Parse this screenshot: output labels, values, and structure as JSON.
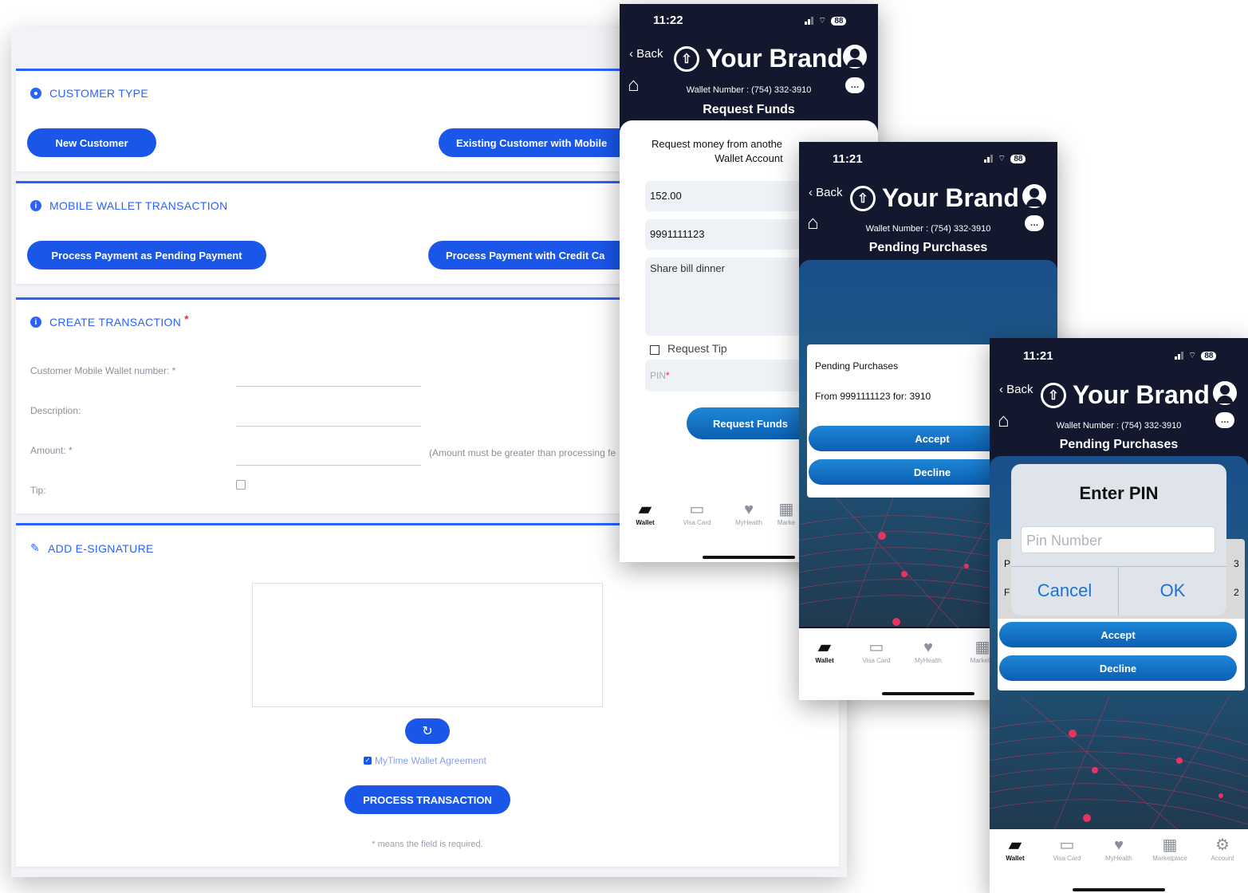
{
  "desktop": {
    "customer_type": {
      "title": "CUSTOMER TYPE",
      "btn_new": "New Customer",
      "btn_existing": "Existing Customer with Mobile"
    },
    "mobile_wallet": {
      "title": "MOBILE WALLET TRANSACTION",
      "btn_pending": "Process Payment as Pending Payment",
      "btn_credit": "Process Payment with Credit Ca"
    },
    "create_transaction": {
      "title": "CREATE TRANSACTION",
      "required_mark": "*",
      "wallet_label": "Customer Mobile Wallet number: *",
      "desc_label": "Description:",
      "amount_label": "Amount: *",
      "amount_hint": "(Amount must be greater than processing fe",
      "tip_label": "Tip:"
    },
    "esignature": {
      "title": "ADD E-SIGNATURE",
      "refresh_icon": "↻",
      "agreement": "MyTime Wallet Agreement",
      "process_btn": "PROCESS TRANSACTION",
      "footnote": "* means the field is required."
    }
  },
  "phone1": {
    "time": "11:22",
    "battery": "88",
    "back": "Back",
    "brand": "Your Brand",
    "wallet_number": "Wallet Number : (754) 332-3910",
    "title": "Request Funds",
    "intro_line1": "Request money from anothe",
    "intro_line2": "Wallet Account",
    "amount": "152.00",
    "phone": "9991111123",
    "note": "Share bill dinner",
    "tip_label": "Request Tip",
    "pin_placeholder": "PIN",
    "pin_req": "*",
    "submit": "Request Funds",
    "tabs": [
      "Wallet",
      "Visa Card",
      "MyHealth",
      "Marke"
    ]
  },
  "phone2": {
    "time": "11:21",
    "battery": "88",
    "back": "Back",
    "brand": "Your Brand",
    "wallet_number": "Wallet Number : (754) 332-3910",
    "title": "Pending Purchases",
    "card_title": "Pending Purchases",
    "card_line": "From 9991111123 for: 3910",
    "accept": "Accept",
    "decline": "Decline",
    "tabs": [
      "Wallet",
      "Visa Card",
      "MyHealth",
      "Marketpl"
    ]
  },
  "phone3": {
    "time": "11:21",
    "battery": "88",
    "back": "Back",
    "brand": "Your Brand",
    "wallet_number": "Wallet Number : (754) 332-3910",
    "title": "Pending Purchases",
    "dialog_title": "Enter PIN",
    "pin_placeholder": "Pin Number",
    "cancel": "Cancel",
    "ok": "OK",
    "bg_p": "P",
    "bg_f": "F",
    "bg_3": "3",
    "bg_2": "2",
    "accept": "Accept",
    "decline": "Decline",
    "tabs": [
      "Wallet",
      "Visa Card",
      "MyHealth",
      "Marketplace",
      "Account"
    ]
  },
  "colors": {
    "primary_blue": "#1a56e8",
    "navy": "#14182e",
    "required_red": "#e53935"
  }
}
